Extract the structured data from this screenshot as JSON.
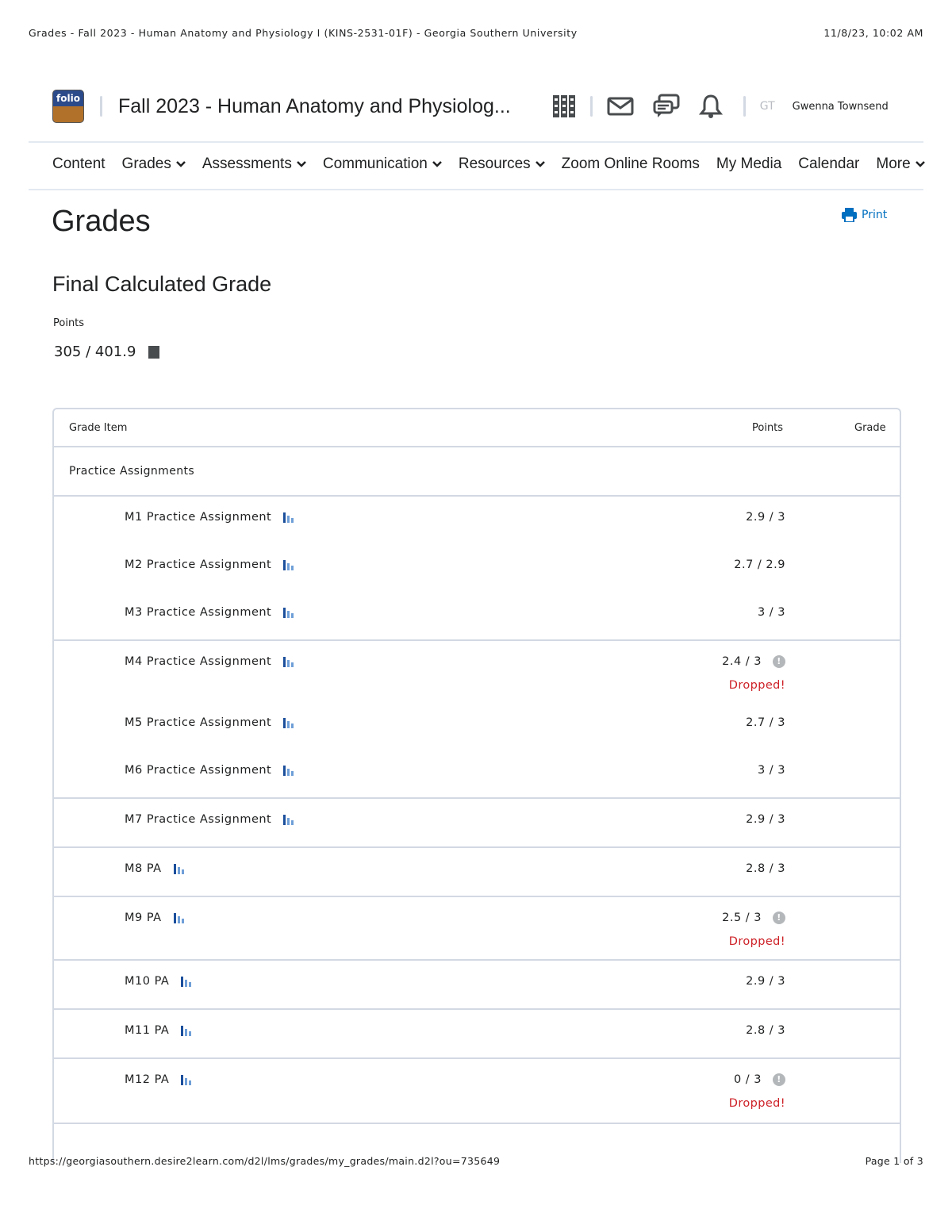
{
  "print_header": {
    "title": "Grades - Fall 2023 - Human Anatomy and Physiology I (KINS-2531-01F) - Georgia Southern University",
    "datetime": "11/8/23, 10:02 AM"
  },
  "print_footer": {
    "url": "https://georgiasouthern.desire2learn.com/d2l/lms/grades/my_grades/main.d2l?ou=735649",
    "page": "Page 1 of 3"
  },
  "minibar": {
    "logo_text": "folio",
    "course_title": "Fall 2023 - Human Anatomy and Physiolog...",
    "user_initials": "GT",
    "user_name": "Gwenna Townsend"
  },
  "nav": {
    "content": "Content",
    "grades": "Grades",
    "assessments": "Assessments",
    "communication": "Communication",
    "resources": "Resources",
    "zoom": "Zoom Online Rooms",
    "my_media": "My Media",
    "calendar": "Calendar",
    "more": "More"
  },
  "page": {
    "title": "Grades",
    "print_label": "Print",
    "final_heading": "Final Calculated Grade",
    "points_label": "Points",
    "points_value": "305 / 401.9"
  },
  "table": {
    "headers": {
      "item": "Grade Item",
      "points": "Points",
      "grade": "Grade"
    },
    "category": "Practice Assignments",
    "rows": [
      {
        "name": "M1 Practice Assignment",
        "points": "2.9 / 3",
        "dropped": ""
      },
      {
        "name": "M2 Practice Assignment",
        "points": "2.7 / 2.9",
        "dropped": ""
      },
      {
        "name": "M3 Practice Assignment",
        "points": "3 / 3",
        "dropped": ""
      },
      {
        "name": "M4 Practice Assignment",
        "points": "2.4 / 3",
        "dropped": "Dropped!"
      },
      {
        "name": "M5 Practice Assignment",
        "points": "2.7 / 3",
        "dropped": ""
      },
      {
        "name": "M6 Practice Assignment",
        "points": "3 / 3",
        "dropped": ""
      },
      {
        "name": "M7 Practice Assignment",
        "points": "2.9 / 3",
        "dropped": ""
      },
      {
        "name": "M8 PA",
        "points": "2.8 / 3",
        "dropped": ""
      },
      {
        "name": "M9 PA",
        "points": "2.5 / 3",
        "dropped": "Dropped!"
      },
      {
        "name": "M10 PA",
        "points": "2.9 / 3",
        "dropped": ""
      },
      {
        "name": "M11 PA",
        "points": "2.8 / 3",
        "dropped": ""
      },
      {
        "name": "M12 PA",
        "points": "0 / 3",
        "dropped": "Dropped!"
      }
    ]
  },
  "colors": {
    "link": "#006fbf",
    "dropped": "#cd2026",
    "border": "#d3d9e3"
  }
}
